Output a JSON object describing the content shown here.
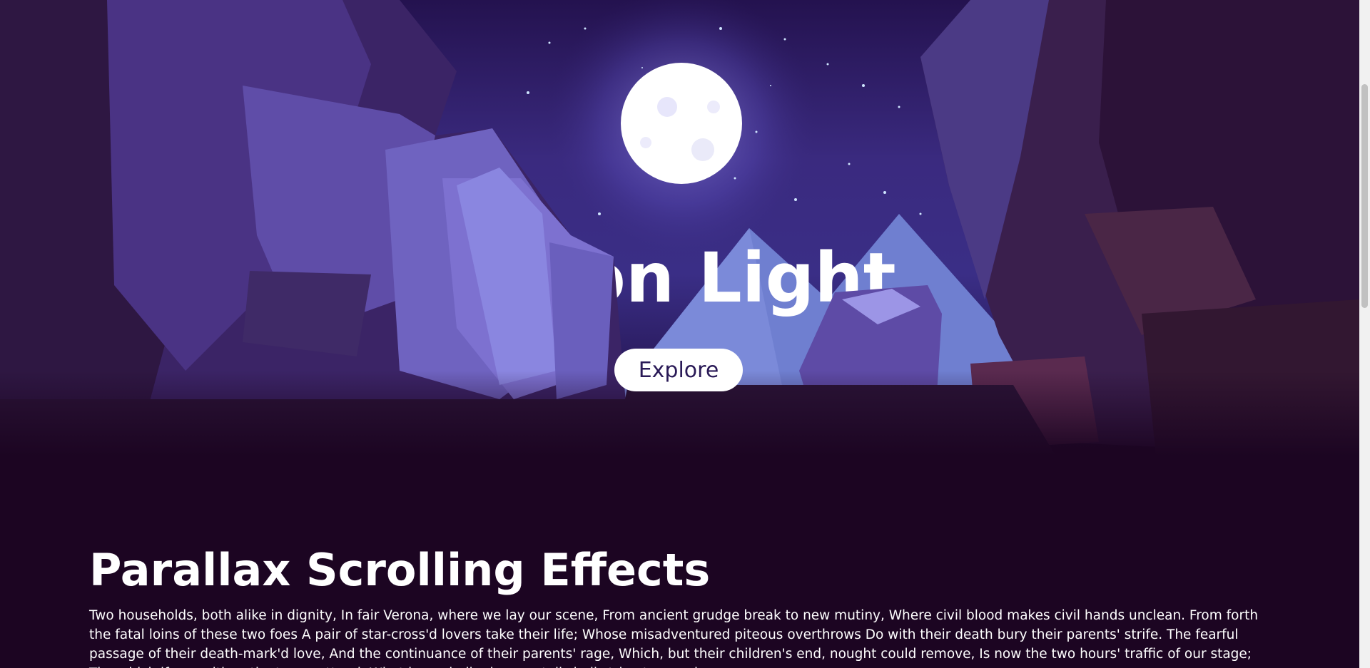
{
  "hero": {
    "title": "Moon Light",
    "button_label": "Explore"
  },
  "article": {
    "heading": "Parallax Scrolling Effects",
    "body": "Two households, both alike in dignity, In fair Verona, where we lay our scene, From ancient grudge break to new mutiny, Where civil blood makes civil hands unclean. From forth the fatal loins of these two foes A pair of star-cross'd lovers take their life; Whose misadventured piteous overthrows Do with their death bury their parents' strife. The fearful passage of their death-mark'd love, And the continuance of their parents' rage, Which, but their children's end, nought could remove, Is now the two hours' traffic of our stage; The which if you with patient ears attend, What here shall miss, our toil shall strive to mend."
  },
  "colors": {
    "page_background": "#1c0522",
    "sky": "#3a2a7f",
    "moon": "#ffffff",
    "button_text": "#2a1a57"
  },
  "icons": {
    "moon": "moon-icon",
    "stars": "stars-icon"
  }
}
